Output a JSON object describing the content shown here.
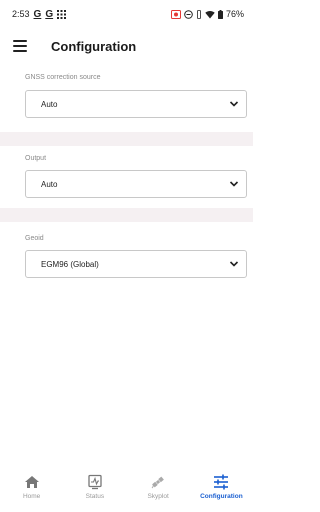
{
  "status_bar": {
    "time": "2:53",
    "left_icons": [
      "G",
      "G"
    ],
    "grid_icon": "grid-icon",
    "battery": "76%",
    "colors": {
      "record_icon": "#e53935"
    }
  },
  "app_bar": {
    "title": "Configuration",
    "menu_icon": "menu-icon"
  },
  "fields": [
    {
      "label": "GNSS correction source",
      "value": "Auto"
    },
    {
      "label": "Output",
      "value": "Auto"
    },
    {
      "label": "Geoid",
      "value": "EGM96 (Global)"
    }
  ],
  "bottom_nav": {
    "active_color": "#1a5fd1",
    "inactive_color": "#9a9a9a",
    "items": [
      {
        "label": "Home",
        "icon": "home-icon"
      },
      {
        "label": "Status",
        "icon": "status-icon"
      },
      {
        "label": "Skyplot",
        "icon": "satellite-icon"
      },
      {
        "label": "Configuration",
        "icon": "tune-icon",
        "active": true
      }
    ]
  }
}
